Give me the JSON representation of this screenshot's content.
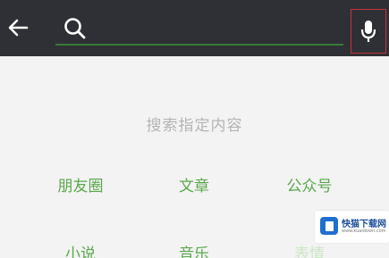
{
  "search": {
    "query": "",
    "placeholder": ""
  },
  "content": {
    "hint": "搜索指定内容",
    "categories": [
      {
        "label": "朋友圈"
      },
      {
        "label": "文章"
      },
      {
        "label": "公众号"
      },
      {
        "label": "小说"
      },
      {
        "label": "音乐"
      },
      {
        "label": "表情"
      }
    ]
  },
  "watermark": {
    "title": "快猫下载网",
    "subtitle": "www.kuaidown.com"
  },
  "colors": {
    "topbar": "#2f3035",
    "accent_green": "#5aa84d",
    "mic_highlight_border": "#c4323a",
    "background": "#f3f3f3"
  },
  "icons": {
    "back": "arrow-left-icon",
    "search": "search-icon",
    "mic": "microphone-icon"
  }
}
